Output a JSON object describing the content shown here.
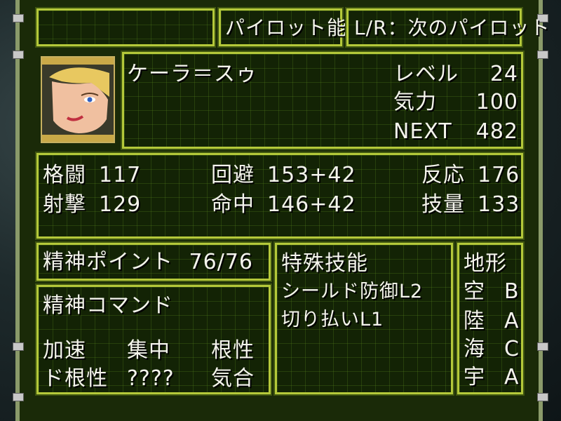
{
  "header": {
    "title": "パイロット能力",
    "hint": "L/R：次のパイロット"
  },
  "pilot": {
    "name": "ケーラ＝スゥ",
    "level_label": "レベル",
    "level": "24",
    "will_label": "気力",
    "will": "100",
    "next_label": "NEXT",
    "next": "482"
  },
  "stats": {
    "melee_label": "格闘",
    "melee": "117",
    "shooting_label": "射撃",
    "shooting": "129",
    "evasion_label": "回避",
    "evasion": "153+42",
    "accuracy_label": "命中",
    "accuracy": "146+42",
    "reaction_label": "反応",
    "reaction": "176",
    "skill_label": "技量",
    "skill": "133"
  },
  "spirit": {
    "points_label": "精神ポイント",
    "points": "76/76",
    "commands_label": "精神コマンド",
    "commands": [
      "加速",
      "集中",
      "根性",
      "ド根性",
      "????",
      "気合"
    ]
  },
  "special_skills": {
    "label": "特殊技能",
    "items": [
      "シールド防御L2",
      "切り払いL1"
    ]
  },
  "terrain": {
    "label": "地形",
    "rows": [
      {
        "name": "空",
        "rank": "B"
      },
      {
        "name": "陸",
        "rank": "A"
      },
      {
        "name": "海",
        "rank": "C"
      },
      {
        "name": "宇",
        "rank": "A"
      }
    ]
  }
}
